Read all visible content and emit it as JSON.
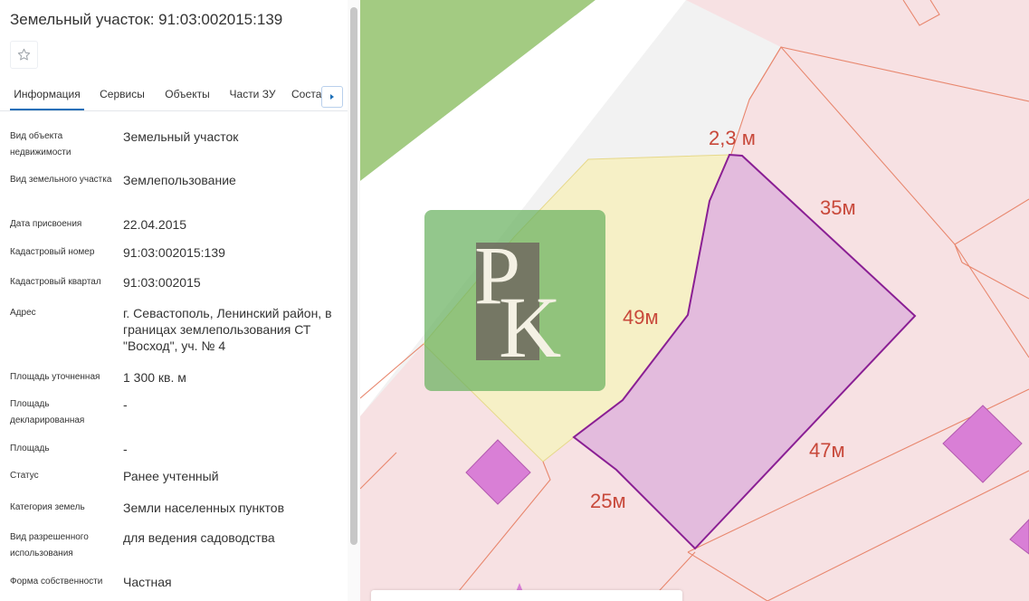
{
  "panel": {
    "title": "Земельный участок: 91:03:002015:139",
    "tabs": [
      {
        "label": "Информация",
        "active": true
      },
      {
        "label": "Сервисы",
        "active": false
      },
      {
        "label": "Объекты",
        "active": false
      },
      {
        "label": "Части ЗУ",
        "active": false
      },
      {
        "label": "Состав",
        "active": false
      }
    ],
    "properties": [
      {
        "key": "Вид объекта недвижимости",
        "value": "Земельный участок"
      },
      {
        "key": "Вид земельного участка",
        "value": "Землепользование"
      },
      {
        "key": "Дата присвоения",
        "value": "22.04.2015"
      },
      {
        "key": "Кадастровый номер",
        "value": "91:03:002015:139"
      },
      {
        "key": "Кадастровый квартал",
        "value": "91:03:002015"
      },
      {
        "key": "Адрес",
        "value": "г. Севастополь, Ленинский район, в границах землепользования СТ \"Восход\", уч. № 4"
      },
      {
        "key": "Площадь уточненная",
        "value": "1 300 кв. м"
      },
      {
        "key": "Площадь декларированная",
        "value": "-"
      },
      {
        "key": "Площадь",
        "value": "-"
      },
      {
        "key": "Статус",
        "value": "Ранее учтенный"
      },
      {
        "key": "Категория земель",
        "value": "Земли населенных пунктов"
      },
      {
        "key": "Вид разрешенного использования",
        "value": "для ведения садоводства"
      },
      {
        "key": "Форма собственности",
        "value": "Частная"
      }
    ]
  },
  "map": {
    "dimensions": [
      "2,3 м",
      "35м",
      "49м",
      "47м",
      "25м"
    ],
    "logo_letters": [
      "P",
      "K"
    ],
    "colors": {
      "parcel_fill": "#e3bbdd",
      "parcel_stroke": "#8a1f94",
      "neighbor_fill": "#f7e1e3",
      "neighbor_stroke": "#e8876e",
      "yellow_zone": "#f6f0c6",
      "green_area": "#a3cb82",
      "building": "#d97fd6",
      "label": "#c8483a"
    }
  }
}
